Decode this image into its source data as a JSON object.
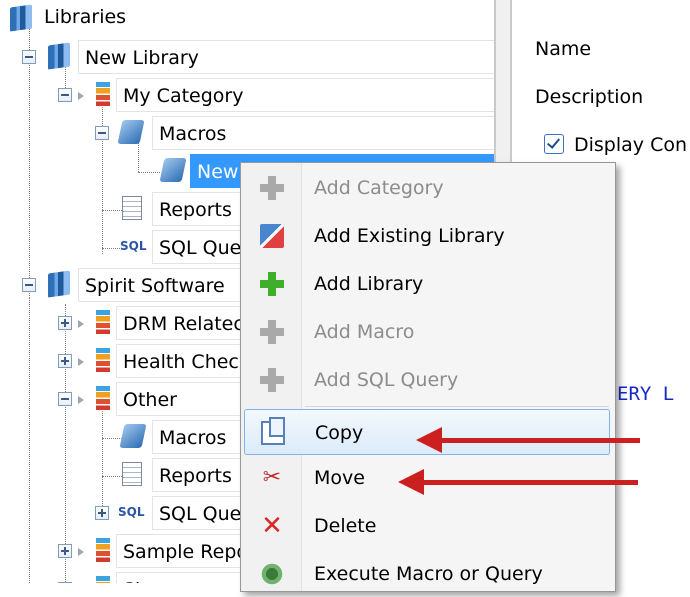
{
  "tree": {
    "nodes": [
      {
        "label": "Libraries"
      },
      {
        "label": "New Library"
      },
      {
        "label": "My Category"
      },
      {
        "label": "Macros"
      },
      {
        "label": "New"
      },
      {
        "label": "Reports"
      },
      {
        "label": "SQL Que"
      },
      {
        "label": "Spirit Software"
      },
      {
        "label": "DRM Relatec"
      },
      {
        "label": "Health Chec"
      },
      {
        "label": "Other"
      },
      {
        "label": "Macros"
      },
      {
        "label": "Reports"
      },
      {
        "label": "SQL Que"
      },
      {
        "label": "Sample Repo"
      },
      {
        "label": "Shar"
      }
    ],
    "sql_icon_text": "SQL"
  },
  "properties": {
    "name_label": "Name",
    "description_label": "Description",
    "display_checkbox_label": "Display Con",
    "code_text": "ERY L"
  },
  "context_menu": {
    "items": [
      {
        "label": "Add Category",
        "enabled": false,
        "icon": "plus-icon"
      },
      {
        "label": "Add Existing Library",
        "enabled": true,
        "icon": "add-existing-library-icon"
      },
      {
        "label": "Add Library",
        "enabled": true,
        "icon": "plus-icon"
      },
      {
        "label": "Add Macro",
        "enabled": false,
        "icon": "plus-icon"
      },
      {
        "label": "Add SQL Query",
        "enabled": false,
        "icon": "plus-icon"
      },
      {
        "label": "Copy",
        "enabled": true,
        "icon": "copy-icon",
        "highlighted": true
      },
      {
        "label": "Move",
        "enabled": true,
        "icon": "scissors-icon"
      },
      {
        "label": "Delete",
        "enabled": true,
        "icon": "delete-icon"
      },
      {
        "label": "Execute Macro or Query",
        "enabled": true,
        "icon": "gear-icon"
      }
    ]
  },
  "colors": {
    "selection": "#3399ff",
    "annotation_arrow": "#cc1f1f",
    "code_text": "#1428c8"
  }
}
